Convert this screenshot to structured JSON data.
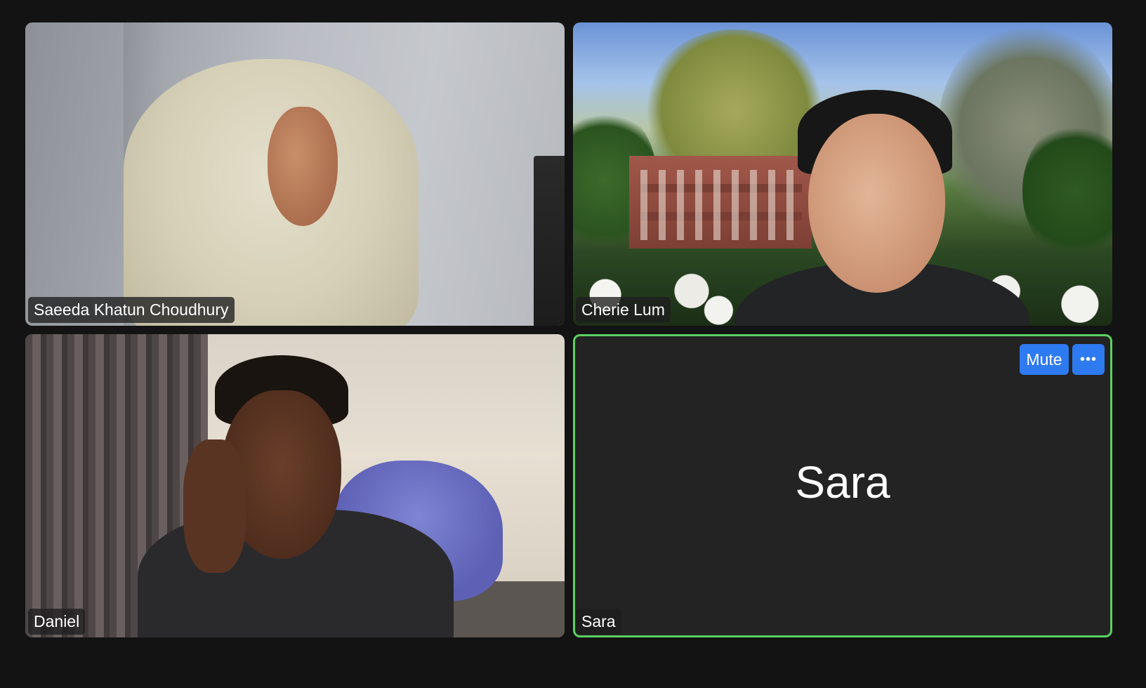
{
  "participants": [
    {
      "name": "Saeeda Khatun Choudhury",
      "video": "on"
    },
    {
      "name": "Cherie Lum",
      "video": "on"
    },
    {
      "name": "Daniel",
      "video": "on"
    },
    {
      "name": "Sara",
      "video": "off",
      "display_name": "Sara",
      "active_speaker": true
    }
  ],
  "self_controls": {
    "mute_label": "Mute",
    "more_label": "•••",
    "more_icon": "more-options-icon"
  },
  "colors": {
    "background": "#131313",
    "active_speaker_border": "#5bd161",
    "button_blue": "#2e7af0",
    "tile_off_background": "#232323"
  }
}
